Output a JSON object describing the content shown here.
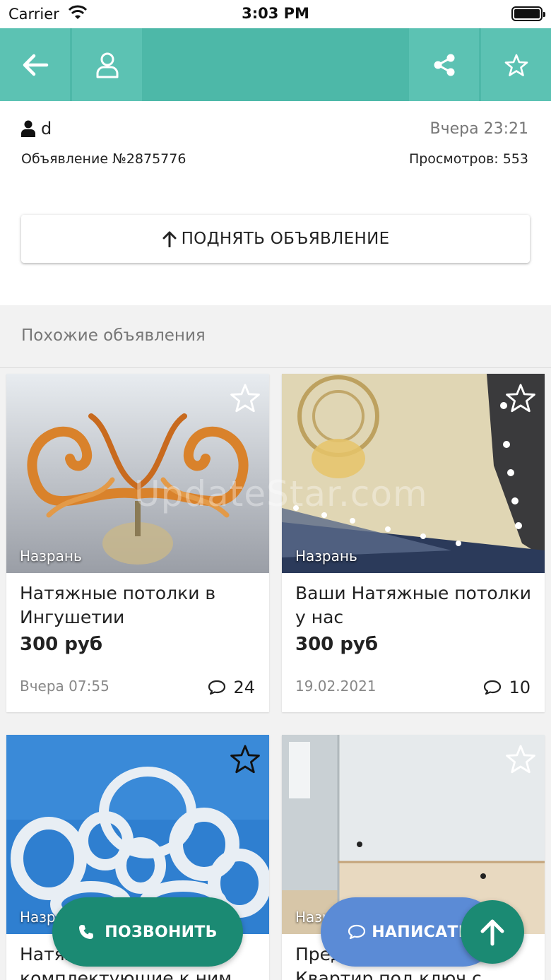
{
  "status_bar": {
    "carrier": "Carrier",
    "time": "3:03 PM"
  },
  "app_bar": {
    "background": "#4db8a8",
    "button_background": "#5cc2b3"
  },
  "listing": {
    "author": "d",
    "posted": "Вчера 23:21",
    "number": "Объявление №2875776",
    "views": "Просмотров: 553",
    "raise_button": "ПОДНЯТЬ ОБЪЯВЛЕНИЕ"
  },
  "similar": {
    "title": "Похожие объявления",
    "watermark": "UpdateStar.com",
    "cards": [
      {
        "city": "Назрань",
        "title": "Натяжные потолки в Ингушетии",
        "price": "300 руб",
        "date": "Вчера 07:55",
        "comments": "24"
      },
      {
        "city": "Назрань",
        "title": "Ваши Натяжные потолки у нас",
        "price": "300 руб",
        "date": "19.02.2021",
        "comments": "10"
      },
      {
        "city": "Назрань",
        "title": "Натяжные потолки и комплектующие к ним",
        "price": "",
        "date": "",
        "comments": ""
      },
      {
        "city": "Назрань",
        "title": "Предлагаем ремонт Квартир под ключ с",
        "price": "",
        "date": "",
        "comments": ""
      }
    ]
  },
  "actions": {
    "call": "ПОЗВОНИТЬ",
    "write": "НАПИСАТЬ"
  },
  "colors": {
    "accent": "#4db8a8",
    "call": "#1b8a73",
    "write": "#5b8bd6"
  }
}
